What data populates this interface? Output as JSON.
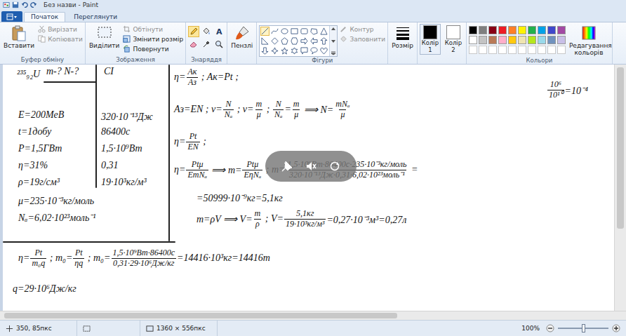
{
  "window": {
    "title": "Без назви - Paint"
  },
  "tabs": [
    {
      "label": "Початок",
      "selected": true
    },
    {
      "label": "Переглянути",
      "selected": false
    }
  ],
  "ribbon": {
    "clipboard": {
      "label": "Буфер обміну",
      "paste": "Вставити",
      "cut": {
        "label": "Вирізати",
        "disabled": true
      },
      "copy": {
        "label": "Копіювати",
        "disabled": true
      }
    },
    "image": {
      "label": "Зображення",
      "select": "Виділити",
      "crop": {
        "label": "Обтінути",
        "disabled": true
      },
      "resize": {
        "label": "Змінити розмір",
        "disabled": false
      },
      "rotate": {
        "label": "Повернути",
        "disabled": false
      }
    },
    "tools": {
      "label": "Знаряддя",
      "items": [
        {
          "kind": "pencil",
          "selected": true
        },
        {
          "kind": "fill",
          "selected": false
        },
        {
          "kind": "text",
          "label": "A",
          "selected": false
        },
        {
          "kind": "eraser",
          "selected": false
        },
        {
          "kind": "picker",
          "selected": false
        },
        {
          "kind": "magnifier",
          "selected": false
        }
      ]
    },
    "brushes": "Пензлі",
    "shapes": {
      "label": "Фігури",
      "items": [
        {
          "kind": "line",
          "selected": true
        },
        {
          "kind": "curve",
          "selected": false
        },
        {
          "kind": "oval",
          "selected": false
        },
        {
          "kind": "rectangle",
          "selected": false
        },
        {
          "kind": "rounded-rectangle",
          "selected": false
        },
        {
          "kind": "polygon",
          "selected": false
        },
        {
          "kind": "triangle",
          "selected": false
        },
        {
          "kind": "right-triangle",
          "selected": false
        },
        {
          "kind": "diamond",
          "selected": false
        },
        {
          "kind": "pentagon",
          "selected": false
        },
        {
          "kind": "hexagon",
          "selected": false
        },
        {
          "kind": "arrow-right",
          "selected": false
        },
        {
          "kind": "arrow-left",
          "selected": false
        },
        {
          "kind": "arrow-up",
          "selected": false
        },
        {
          "kind": "arrow-down",
          "selected": false
        },
        {
          "kind": "star4",
          "selected": false
        },
        {
          "kind": "star5",
          "selected": false
        },
        {
          "kind": "star6",
          "selected": false
        },
        {
          "kind": "callout-rect",
          "selected": false
        },
        {
          "kind": "callout-oval",
          "selected": false
        },
        {
          "kind": "heart",
          "selected": false
        }
      ],
      "outline": {
        "label": "Контур",
        "disabled": true
      },
      "fill": {
        "label": "Заповнити",
        "disabled": true
      }
    },
    "size": "Розмір",
    "color1": {
      "label": "Колір 1",
      "color": "#000000",
      "selected": true
    },
    "color2": {
      "label": "Колір 2",
      "color": "#ffffff",
      "selected": false
    },
    "colors": {
      "label": "Кольори",
      "palette": [
        {
          "color": "#000000"
        },
        {
          "color": "#7f7f7f"
        },
        {
          "color": "#880015"
        },
        {
          "color": "#ed1c24"
        },
        {
          "color": "#ff7f27"
        },
        {
          "color": "#fff200"
        },
        {
          "color": "#22b14c"
        },
        {
          "color": "#00a2e8"
        },
        {
          "color": "#3f48cc"
        },
        {
          "color": "#a349a4"
        },
        {
          "color": "#ffffff"
        },
        {
          "color": "#c3c3c3"
        },
        {
          "color": "#b97a57"
        },
        {
          "color": "#ffaec9"
        },
        {
          "color": "#ffc90e"
        },
        {
          "color": "#efe4b0"
        },
        {
          "color": "#b5e61d"
        },
        {
          "color": "#99d9ea"
        },
        {
          "color": "#7092be"
        },
        {
          "color": "#c8bfe7"
        }
      ]
    },
    "edit_colors": "Редагування кольорів"
  },
  "canvas": {
    "notes": [
      {
        "segments": [
          {
            "kind": "text",
            "text": "²³⁵₉₂U"
          }
        ]
      },
      {
        "segments": [
          {
            "kind": "text",
            "text": "m-? N-?"
          }
        ]
      },
      {
        "segments": [
          {
            "kind": "text",
            "text": "СІ"
          }
        ]
      },
      {
        "segments": [
          {
            "kind": "text",
            "text": "E=200МеВ"
          }
        ]
      },
      {
        "segments": [
          {
            "kind": "text",
            "text": "t=1добу"
          }
        ]
      },
      {
        "segments": [
          {
            "kind": "text",
            "text": "P=1,5ГВт"
          }
        ]
      },
      {
        "segments": [
          {
            "kind": "text",
            "text": "η=31%"
          }
        ]
      },
      {
        "segments": [
          {
            "kind": "text",
            "text": "ρ=19г/см³"
          }
        ]
      },
      {
        "segments": [
          {
            "kind": "text",
            "text": "μ=235·10⁻³кг/моль"
          }
        ]
      },
      {
        "segments": [
          {
            "kind": "text",
            "text": "Nₐ=6,02·10²³моль⁻¹"
          }
        ]
      },
      {
        "segments": [
          {
            "kind": "text",
            "text": "320·10⁻¹³Дж"
          }
        ]
      },
      {
        "segments": [
          {
            "kind": "text",
            "text": "86400с"
          }
        ]
      },
      {
        "segments": [
          {
            "kind": "text",
            "text": "1,5·10⁹Вт"
          }
        ]
      },
      {
        "segments": [
          {
            "kind": "text",
            "text": "0,31"
          }
        ]
      },
      {
        "segments": [
          {
            "kind": "text",
            "text": "19·10³кг/м³"
          }
        ]
      },
      {
        "segments": [
          {
            "kind": "text",
            "text": "η="
          },
          {
            "kind": "fraction",
            "num": "Aк",
            "den": "Aз"
          },
          {
            "kind": "text",
            "text": " ; Aк=Pt ;"
          }
        ]
      },
      {
        "segments": [
          {
            "kind": "text",
            "text": "Aз=EN ; ν="
          },
          {
            "kind": "fraction",
            "num": "N",
            "den": "Nₐ"
          },
          {
            "kind": "text",
            "text": " ; ν="
          },
          {
            "kind": "fraction",
            "num": "m",
            "den": "μ"
          },
          {
            "kind": "text",
            "text": " ; "
          },
          {
            "kind": "fraction",
            "num": "N",
            "den": "Nₐ"
          },
          {
            "kind": "text",
            "text": "="
          },
          {
            "kind": "fraction",
            "num": "m",
            "den": "μ"
          },
          {
            "kind": "text",
            "text": " ⟹ N="
          },
          {
            "kind": "fraction",
            "num": "mNₐ",
            "den": "μ"
          }
        ]
      },
      {
        "segments": [
          {
            "kind": "fraction",
            "num": "10⁶",
            "den": "10¹⁰"
          },
          {
            "kind": "text",
            "text": "=10⁻⁴"
          }
        ]
      },
      {
        "segments": [
          {
            "kind": "text",
            "text": "η="
          },
          {
            "kind": "fraction",
            "num": "Pt",
            "den": "EN"
          },
          {
            "kind": "text",
            "text": " ;"
          }
        ]
      },
      {
        "segments": [
          {
            "kind": "text",
            "text": "η="
          },
          {
            "kind": "fraction",
            "num": "Ptμ",
            "den": "EmNₐ"
          },
          {
            "kind": "text",
            "text": " ⟹ m="
          },
          {
            "kind": "fraction",
            "num": "Ptμ",
            "den": "EηNₐ"
          },
          {
            "kind": "text",
            "text": " ; m="
          },
          {
            "kind": "fraction",
            "num": "1,5·10⁹Вт·86400с·235·10⁻³кг/моль",
            "den": "320·10⁻¹³Дж·0,31·6,02·10²³моль⁻¹"
          },
          {
            "kind": "text",
            "text": " ="
          }
        ]
      },
      {
        "segments": [
          {
            "kind": "text",
            "text": "=50999·10⁻⁹кг=5,1кг"
          }
        ]
      },
      {
        "segments": [
          {
            "kind": "text",
            "text": "m=ρV ⟹ V="
          },
          {
            "kind": "fraction",
            "num": "m",
            "den": "ρ"
          },
          {
            "kind": "text",
            "text": " ; V="
          },
          {
            "kind": "fraction",
            "num": "5,1кг",
            "den": "19·10³кг/м³"
          },
          {
            "kind": "text",
            "text": "=0,27·10⁻³м³=0,27л"
          }
        ]
      },
      {
        "segments": [
          {
            "kind": "text",
            "text": "η="
          },
          {
            "kind": "fraction",
            "num": "Pt",
            "den": "m₀q"
          },
          {
            "kind": "text",
            "text": " ; m₀="
          },
          {
            "kind": "fraction",
            "num": "Pt",
            "den": "ηq"
          },
          {
            "kind": "text",
            "text": " ; m₀="
          },
          {
            "kind": "fraction",
            "num": "1,5·10⁹Вт·86400с",
            "den": "0,31·29·10⁶Дж/кг"
          },
          {
            "kind": "text",
            "text": "=14416·10³кг=14416т"
          }
        ]
      },
      {
        "segments": [
          {
            "kind": "text",
            "text": "q=29·10⁶Дж/кг"
          }
        ]
      }
    ]
  },
  "status_bar": {
    "cursor": "350, 85пкс",
    "size": "1360 × 556пкс",
    "zoom": "100%",
    "zoom_level": 0.5
  }
}
